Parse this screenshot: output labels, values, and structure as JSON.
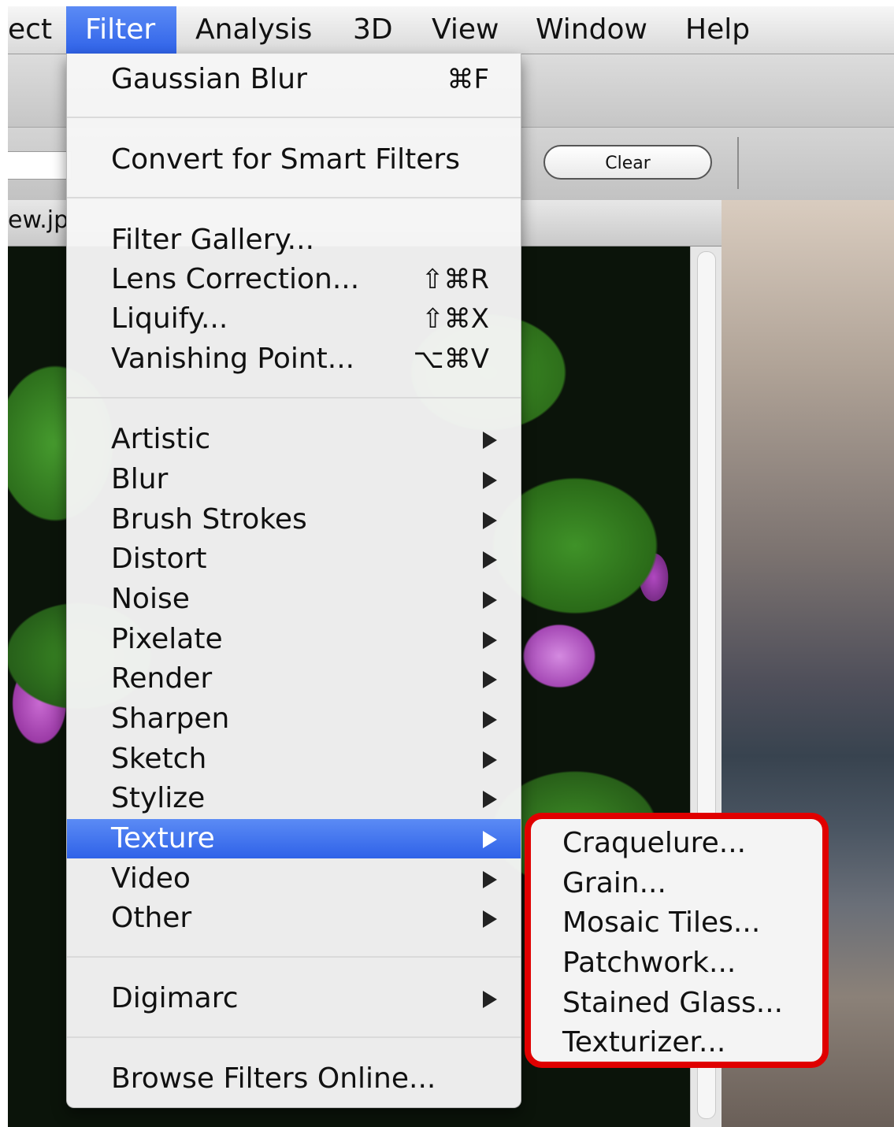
{
  "menubar": {
    "items": [
      "ect",
      "Filter",
      "Analysis",
      "3D",
      "View",
      "Window",
      "Help"
    ],
    "active": "Filter"
  },
  "toolbar": {
    "clear_label": "Clear"
  },
  "document": {
    "title_fragment": "ew.jp"
  },
  "filter_menu": {
    "gaussian_blur": {
      "label": "Gaussian Blur",
      "shortcut": "⌘F"
    },
    "convert_smart_filters": {
      "label": "Convert for Smart Filters"
    },
    "filter_gallery": {
      "label": "Filter Gallery..."
    },
    "lens_correction": {
      "label": "Lens Correction...",
      "shortcut": "⇧⌘R"
    },
    "liquify": {
      "label": "Liquify...",
      "shortcut": "⇧⌘X"
    },
    "vanishing_point": {
      "label": "Vanishing Point...",
      "shortcut": "⌥⌘V"
    },
    "submenus": [
      "Artistic",
      "Blur",
      "Brush Strokes",
      "Distort",
      "Noise",
      "Pixelate",
      "Render",
      "Sharpen",
      "Sketch",
      "Stylize",
      "Texture",
      "Video",
      "Other"
    ],
    "highlighted": "Texture",
    "digimarc": {
      "label": "Digimarc"
    },
    "browse_online": {
      "label": "Browse Filters Online..."
    }
  },
  "texture_submenu": {
    "items": [
      "Craquelure...",
      "Grain...",
      "Mosaic Tiles...",
      "Patchwork...",
      "Stained Glass...",
      "Texturizer..."
    ],
    "highlight_color": "#e00000"
  },
  "colors": {
    "menu_highlight": "#3a6cec"
  }
}
